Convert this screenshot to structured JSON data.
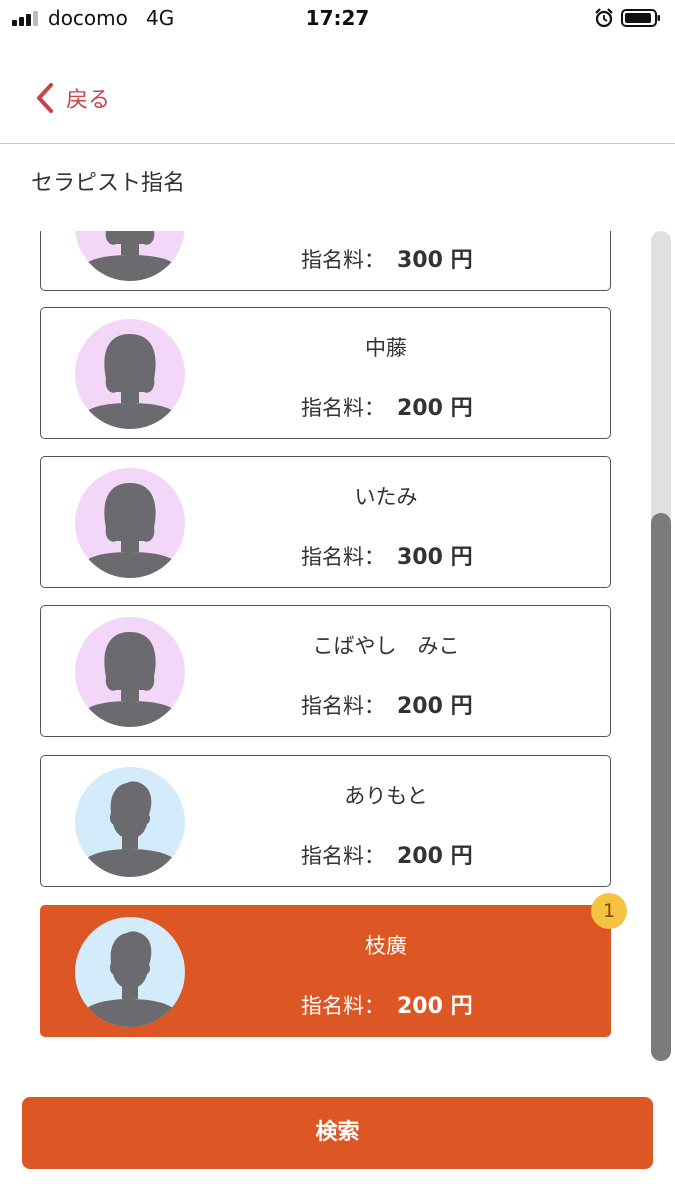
{
  "status_bar": {
    "carrier": "docomo",
    "network": "4G",
    "time": "17:27"
  },
  "header": {
    "back_label": "戻る"
  },
  "section_title": "セラピスト指名",
  "fee_label": "指名料：",
  "therapists": [
    {
      "name": "",
      "fee": "300 円",
      "gender": "female",
      "selected": false
    },
    {
      "name": "中藤",
      "fee": "200 円",
      "gender": "female",
      "selected": false
    },
    {
      "name": "いたみ",
      "fee": "300 円",
      "gender": "female",
      "selected": false
    },
    {
      "name": "こばやし　みこ",
      "fee": "200 円",
      "gender": "female",
      "selected": false
    },
    {
      "name": "ありもと",
      "fee": "200 円",
      "gender": "male",
      "selected": false
    },
    {
      "name": "枝廣",
      "fee": "200 円",
      "gender": "male",
      "selected": true
    }
  ],
  "selected_badge": "1",
  "search_button": "検索",
  "colors": {
    "accent": "#dd5725",
    "back_link": "#c8434b",
    "female_avatar_bg": "#f3d7f8",
    "male_avatar_bg": "#d4ebfb",
    "badge": "#f5c242"
  },
  "icons": {
    "female_avatar": "female-silhouette-icon",
    "male_avatar": "male-silhouette-icon",
    "back": "chevron-left-icon"
  }
}
